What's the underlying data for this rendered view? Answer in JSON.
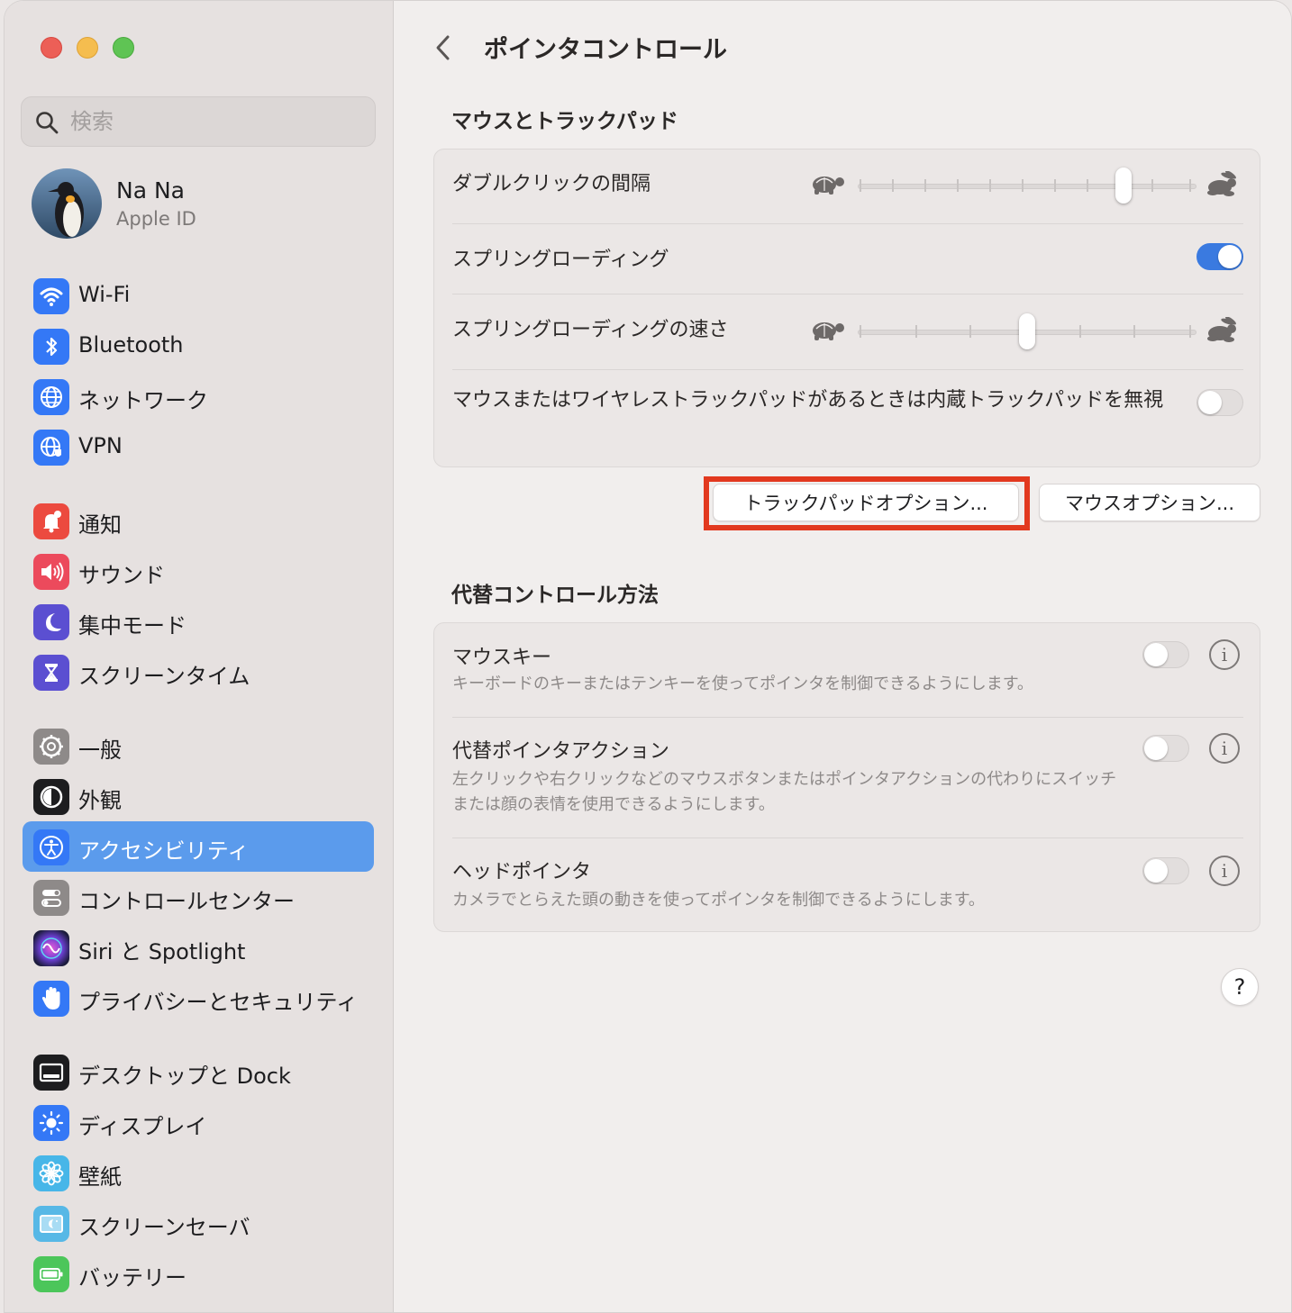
{
  "sidebar": {
    "search_placeholder": "検索",
    "profile": {
      "name": "Na Na",
      "subtitle": "Apple ID"
    },
    "items": [
      {
        "label": "Wi-Fi",
        "icon": "wifi-icon",
        "color": "#3478f6"
      },
      {
        "label": "Bluetooth",
        "icon": "bluetooth-icon",
        "color": "#3478f6"
      },
      {
        "label": "ネットワーク",
        "icon": "globe-icon",
        "color": "#3478f6"
      },
      {
        "label": "VPN",
        "icon": "vpn-globe-icon",
        "color": "#3478f6"
      },
      {
        "label": "通知",
        "icon": "bell-icon",
        "color": "#ec4a3f"
      },
      {
        "label": "サウンド",
        "icon": "speaker-icon",
        "color": "#ec4a5c"
      },
      {
        "label": "集中モード",
        "icon": "moon-icon",
        "color": "#5b4fd1"
      },
      {
        "label": "スクリーンタイム",
        "icon": "hourglass-icon",
        "color": "#5b4fd1"
      },
      {
        "label": "一般",
        "icon": "gear-icon",
        "color": "#8e8a89"
      },
      {
        "label": "外観",
        "icon": "appearance-icon",
        "color": "#1d1d1f"
      },
      {
        "label": "アクセシビリティ",
        "icon": "accessibility-icon",
        "color": "#3478f6",
        "active": true
      },
      {
        "label": "コントロールセンター",
        "icon": "control-center-icon",
        "color": "#8e8a89"
      },
      {
        "label": "Siri と Spotlight",
        "icon": "siri-icon",
        "color": "#6b3fd1"
      },
      {
        "label": "プライバシーとセキュリティ",
        "icon": "hand-icon",
        "color": "#3478f6"
      },
      {
        "label": "デスクトップと Dock",
        "icon": "dock-icon",
        "color": "#1d1d1f"
      },
      {
        "label": "ディスプレイ",
        "icon": "sun-icon",
        "color": "#3478f6"
      },
      {
        "label": "壁紙",
        "icon": "flower-icon",
        "color": "#47b6e8"
      },
      {
        "label": "スクリーンセーバ",
        "icon": "screensaver-icon",
        "color": "#57b8e6"
      },
      {
        "label": "バッテリー",
        "icon": "battery-icon",
        "color": "#4cc65a"
      }
    ]
  },
  "main": {
    "title": "ポインタコントロール",
    "section1": {
      "title": "マウスとトラックパッド",
      "double_click_label": "ダブルクリックの間隔",
      "double_click_value": 0.8,
      "spring_loading_label": "スプリングローディング",
      "spring_loading_on": true,
      "spring_speed_label": "スプリングローディングの速さ",
      "spring_speed_value": 0.5,
      "ignore_trackpad_label": "マウスまたはワイヤレストラックパッドがあるときは内蔵トラックパッドを無視",
      "ignore_trackpad_on": false
    },
    "buttons": {
      "trackpad_options": "トラックパッドオプション...",
      "mouse_options": "マウスオプション..."
    },
    "section2": {
      "title": "代替コントロール方法",
      "rows": [
        {
          "label": "マウスキー",
          "desc": "キーボードのキーまたはテンキーを使ってポインタを制御できるようにします。",
          "on": false
        },
        {
          "label": "代替ポインタアクション",
          "desc": "左クリックや右クリックなどのマウスボタンまたはポインタアクションの代わりにスイッチまたは顔の表情を使用できるようにします。",
          "on": false
        },
        {
          "label": "ヘッドポインタ",
          "desc": "カメラでとらえた頭の動きを使ってポインタを制御できるようにします。",
          "on": false
        }
      ]
    },
    "help": "?",
    "highlight_color": "#e2391f",
    "accent_color": "#3a7ae0"
  }
}
